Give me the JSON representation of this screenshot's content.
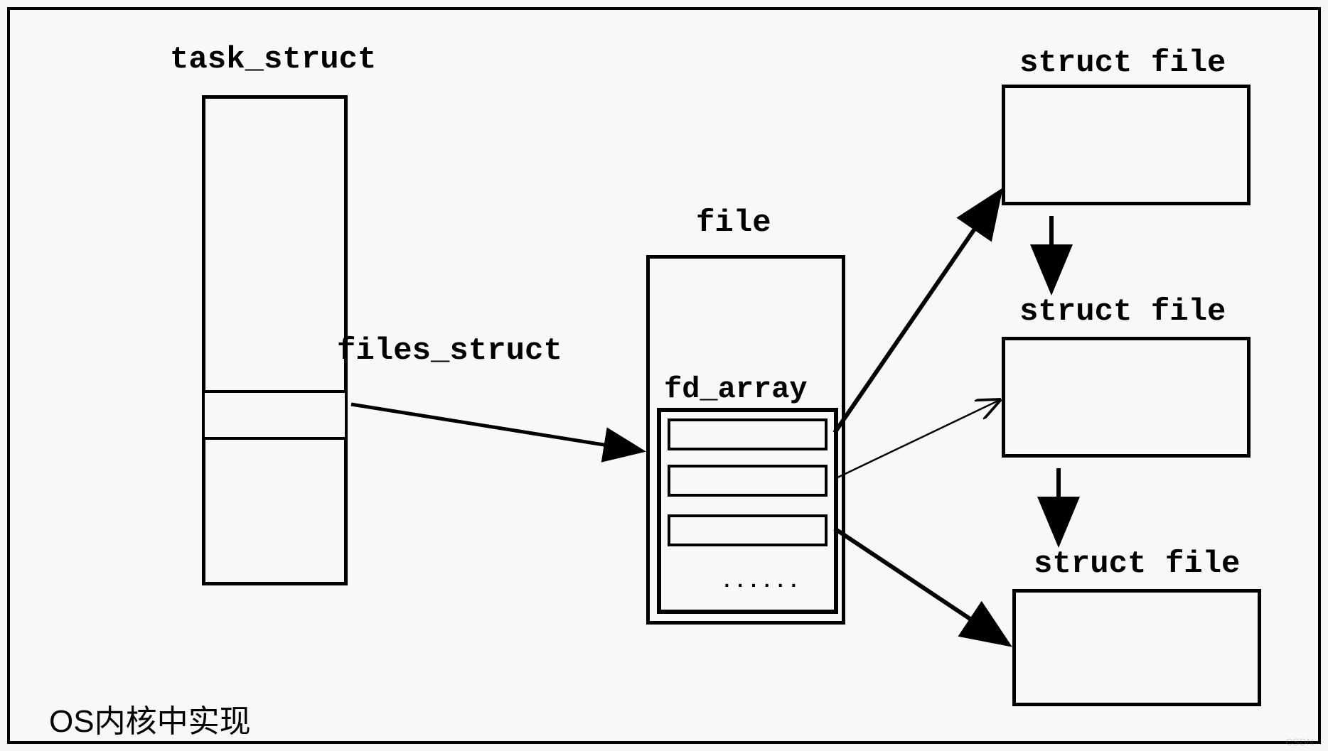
{
  "labels": {
    "task_struct": "task_struct",
    "files_struct": "files_struct",
    "file": "file",
    "fd_array": "fd_array",
    "struct_file_1": "struct file",
    "struct_file_2": "struct file",
    "struct_file_3": "struct file",
    "footer": "OS内核中实现",
    "ellipsis": "......"
  }
}
